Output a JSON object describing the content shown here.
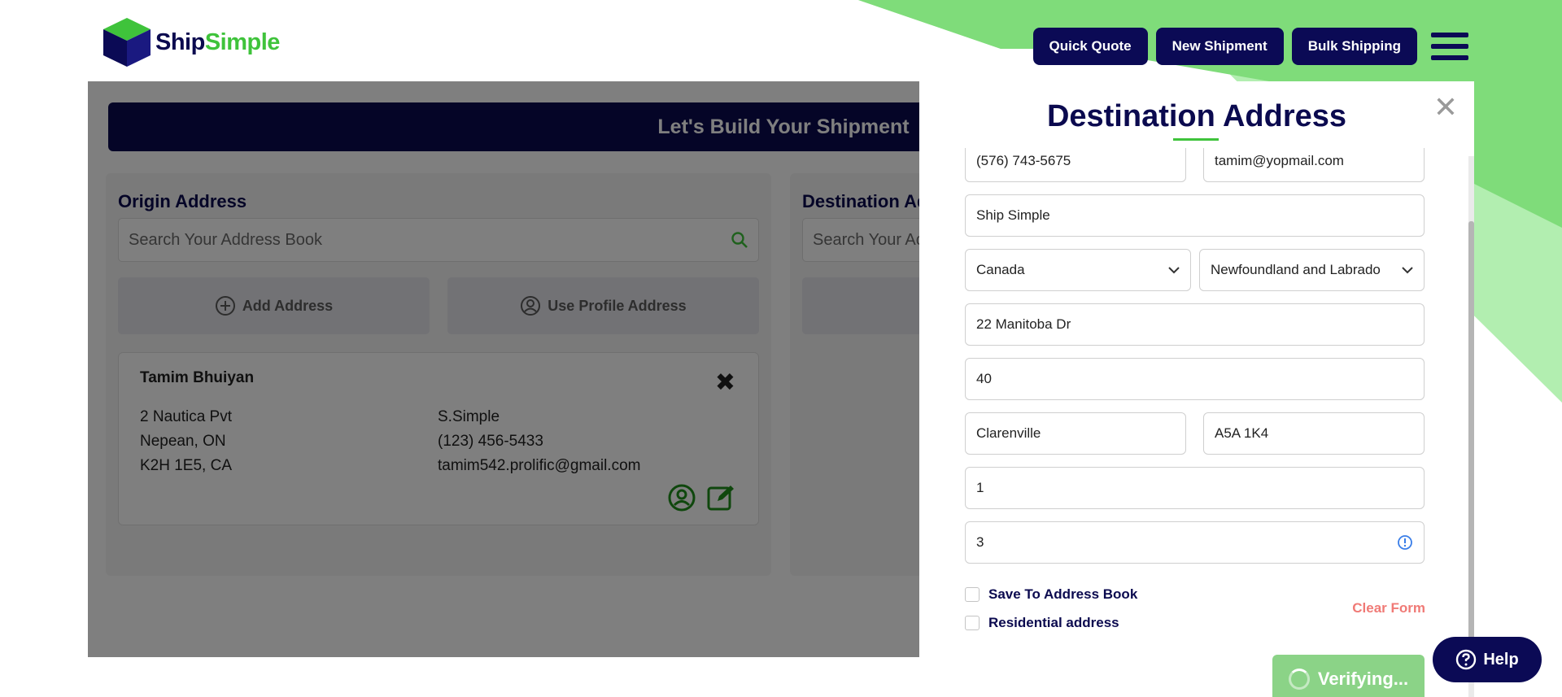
{
  "brand": {
    "name_part1": "Ship",
    "name_part2": "Simple",
    "green": "#3fc33b",
    "navy": "#0b0a4f"
  },
  "nav": {
    "quick_quote": "Quick Quote",
    "new_shipment": "New Shipment",
    "bulk_shipping": "Bulk Shipping",
    "menu_icon": "hamburger-icon"
  },
  "banner": {
    "title": "Let's Build Your Shipment"
  },
  "origin": {
    "title": "Origin Address",
    "search_placeholder": "Search Your Address Book",
    "add_address": "Add Address",
    "use_profile": "Use Profile Address",
    "card": {
      "name": "Tamim Bhuiyan",
      "line1": "2 Nautica Pvt",
      "line2": "Nepean, ON",
      "line3": "K2H 1E5, CA",
      "company": "S.Simple",
      "phone": "(123) 456-5433",
      "email": "tamim542.prolific@gmail.com"
    }
  },
  "destination_bg": {
    "title": "Destination Ad",
    "search_placeholder": "Search Your Ac"
  },
  "modal": {
    "title": "Destination Address",
    "phone": "(576) 743-5675",
    "email": "tamim@yopmail.com",
    "company": "Ship Simple",
    "country": "Canada",
    "province": "Newfoundland and Labrado",
    "address1": "22 Manitoba Dr",
    "address2": "40",
    "city": "Clarenville",
    "postal": "A5A 1K4",
    "field_a": "1",
    "field_b": "3",
    "save_to_book": "Save To Address Book",
    "residential": "Residential address",
    "clear_form": "Clear Form"
  },
  "verify": {
    "label": "Verifying..."
  },
  "help": {
    "label": "Help"
  }
}
